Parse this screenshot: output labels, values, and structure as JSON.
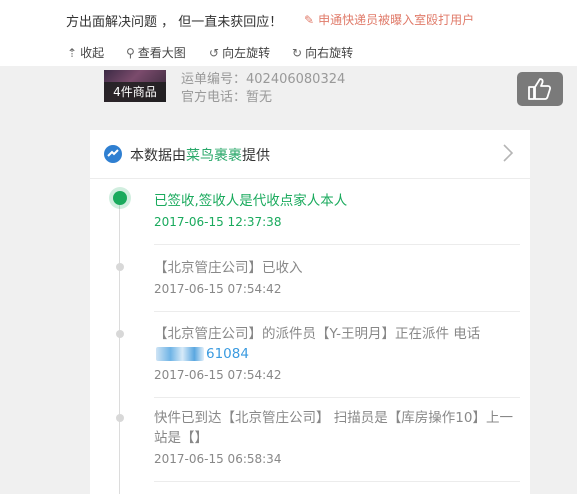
{
  "top": {
    "text": "方出面解决问题 ， 但一直未获回应！",
    "related_link": "申通快递员被曝入室殴打用户"
  },
  "toolbar": {
    "collapse": "收起",
    "view_large": "查看大图",
    "rotate_left": "向左旋转",
    "rotate_right": "向右旋转"
  },
  "shipment": {
    "goods_badge": "4件商品",
    "waybill_label": "运单编号：",
    "waybill_no": "402406080324",
    "phone_label": "官方电话：",
    "phone_value": "暂无"
  },
  "card": {
    "title_prefix": "本数据由",
    "title_brand": "菜鸟裹裹",
    "title_suffix": "提供"
  },
  "events": [
    {
      "msg": "已签收,签收人是代收点家人本人",
      "time": "2017-06-15 12:37:38"
    },
    {
      "msg": "【北京管庄公司】已收入",
      "time": "2017-06-15 07:54:42"
    },
    {
      "msg_a": "【北京管庄公司】的派件员【Y-王明月】正在派件 电话",
      "msg_phone": "61084",
      "time": "2017-06-15 07:54:42"
    },
    {
      "msg": "快件已到达【北京管庄公司】 扫描员是【库房操作10】上一站是【】",
      "time": "2017-06-15 06:58:34"
    }
  ],
  "colors": {
    "accent_green": "#1aaa5d",
    "link_red": "#e07b6a",
    "brand_blue": "#2f7fd1"
  }
}
